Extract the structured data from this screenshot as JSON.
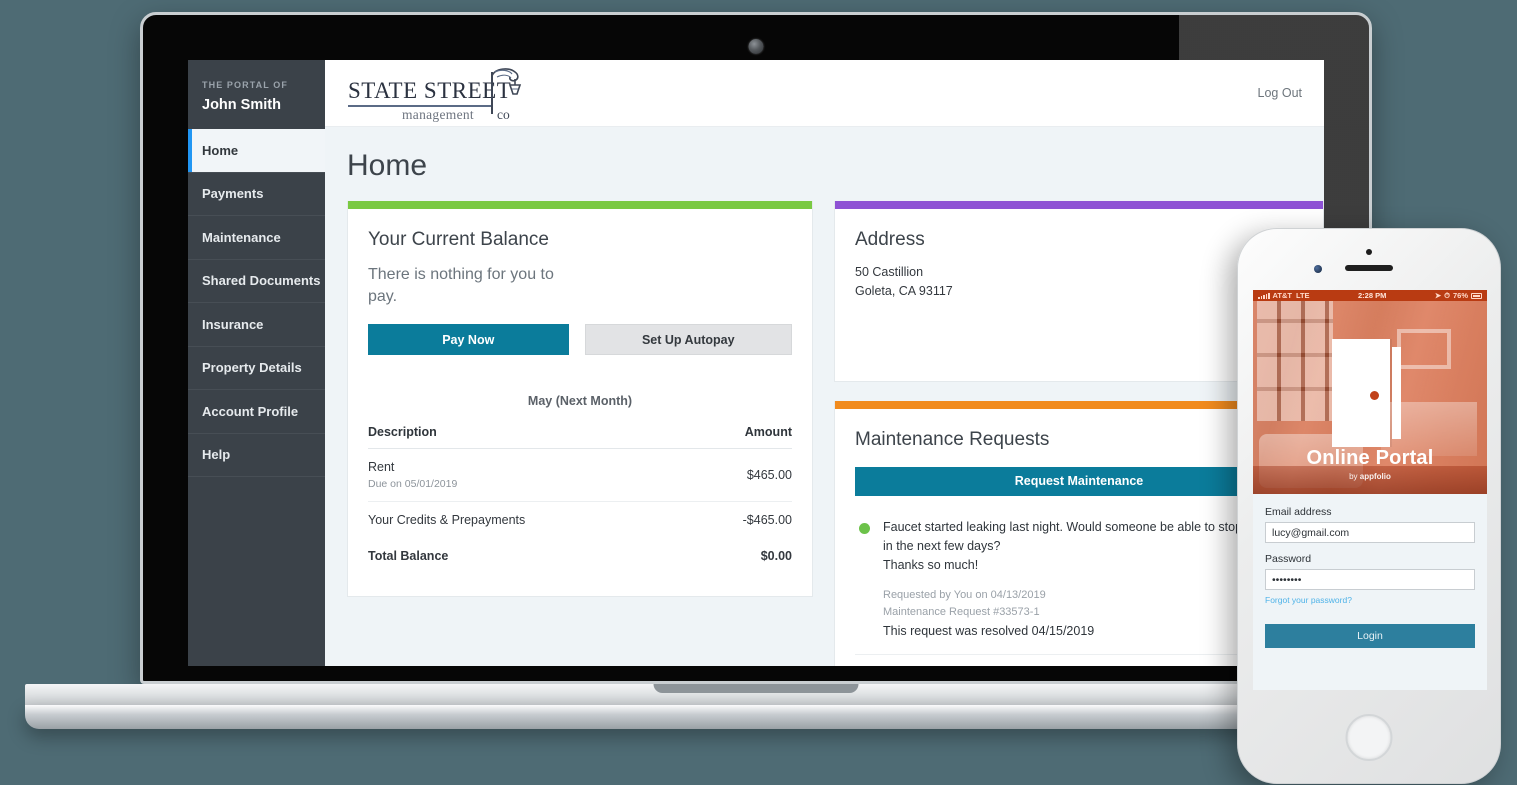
{
  "sidebar": {
    "kicker": "THE PORTAL OF",
    "user_name": "John Smith",
    "items": [
      {
        "label": "Home",
        "active": true
      },
      {
        "label": "Payments",
        "active": false
      },
      {
        "label": "Maintenance",
        "active": false
      },
      {
        "label": "Shared Documents",
        "active": false
      },
      {
        "label": "Insurance",
        "active": false
      },
      {
        "label": "Property Details",
        "active": false
      },
      {
        "label": "Account Profile",
        "active": false
      },
      {
        "label": "Help",
        "active": false
      }
    ]
  },
  "topbar": {
    "logo_main": "STATE STREET",
    "logo_sub": "management",
    "logo_sub2": "co",
    "logout_label": "Log Out"
  },
  "page": {
    "title": "Home"
  },
  "balance_card": {
    "accent_color": "#7ac943",
    "title": "Your Current Balance",
    "message": "There is nothing for you to pay.",
    "pay_now_label": "Pay Now",
    "autopay_label": "Set Up Autopay",
    "month_label": "May (Next Month)",
    "columns": [
      "Description",
      "Amount"
    ],
    "rows": [
      {
        "description": "Rent",
        "sub": "Due on 05/01/2019",
        "amount": "$465.00",
        "bold": false
      },
      {
        "description": "Your Credits & Prepayments",
        "sub": "",
        "amount": "-$465.00",
        "bold": false
      },
      {
        "description": "Total Balance",
        "sub": "",
        "amount": "$0.00",
        "bold": true
      }
    ]
  },
  "address_card": {
    "accent_color": "#8e52d4",
    "title": "Address",
    "line1": "50 Castillion",
    "line2": "Goleta, CA 93117"
  },
  "maintenance_card": {
    "accent_color": "#f18b1e",
    "title": "Maintenance Requests",
    "request_button_label": "Request Maintenance",
    "status_color": "#6cc24a",
    "request_text_1": "Faucet started leaking last night. Would someone be able to stop by a",
    "request_text_2": "in the next few days?",
    "request_text_3": "Thanks so much!",
    "requested_by": "Requested by You on 04/13/2019",
    "request_number": "Maintenance Request #33573-1",
    "resolved_text": "This request was resolved 04/15/2019"
  },
  "bottom_card": {
    "accent_color": "#e5158f"
  },
  "phone": {
    "status": {
      "carrier": "AT&T",
      "network": "LTE",
      "time": "2:28 PM",
      "battery": "76%"
    },
    "splash": {
      "title": "Online Portal",
      "subtitle_prefix": "by ",
      "brand": "appfolio"
    },
    "login": {
      "email_label": "Email address",
      "email_value": "lucy@gmail.com",
      "email_placeholder": "Email address",
      "password_label": "Password",
      "password_value": "••••••••",
      "password_placeholder": "Password",
      "forgot_label": "Forgot your password?",
      "login_label": "Login"
    }
  }
}
